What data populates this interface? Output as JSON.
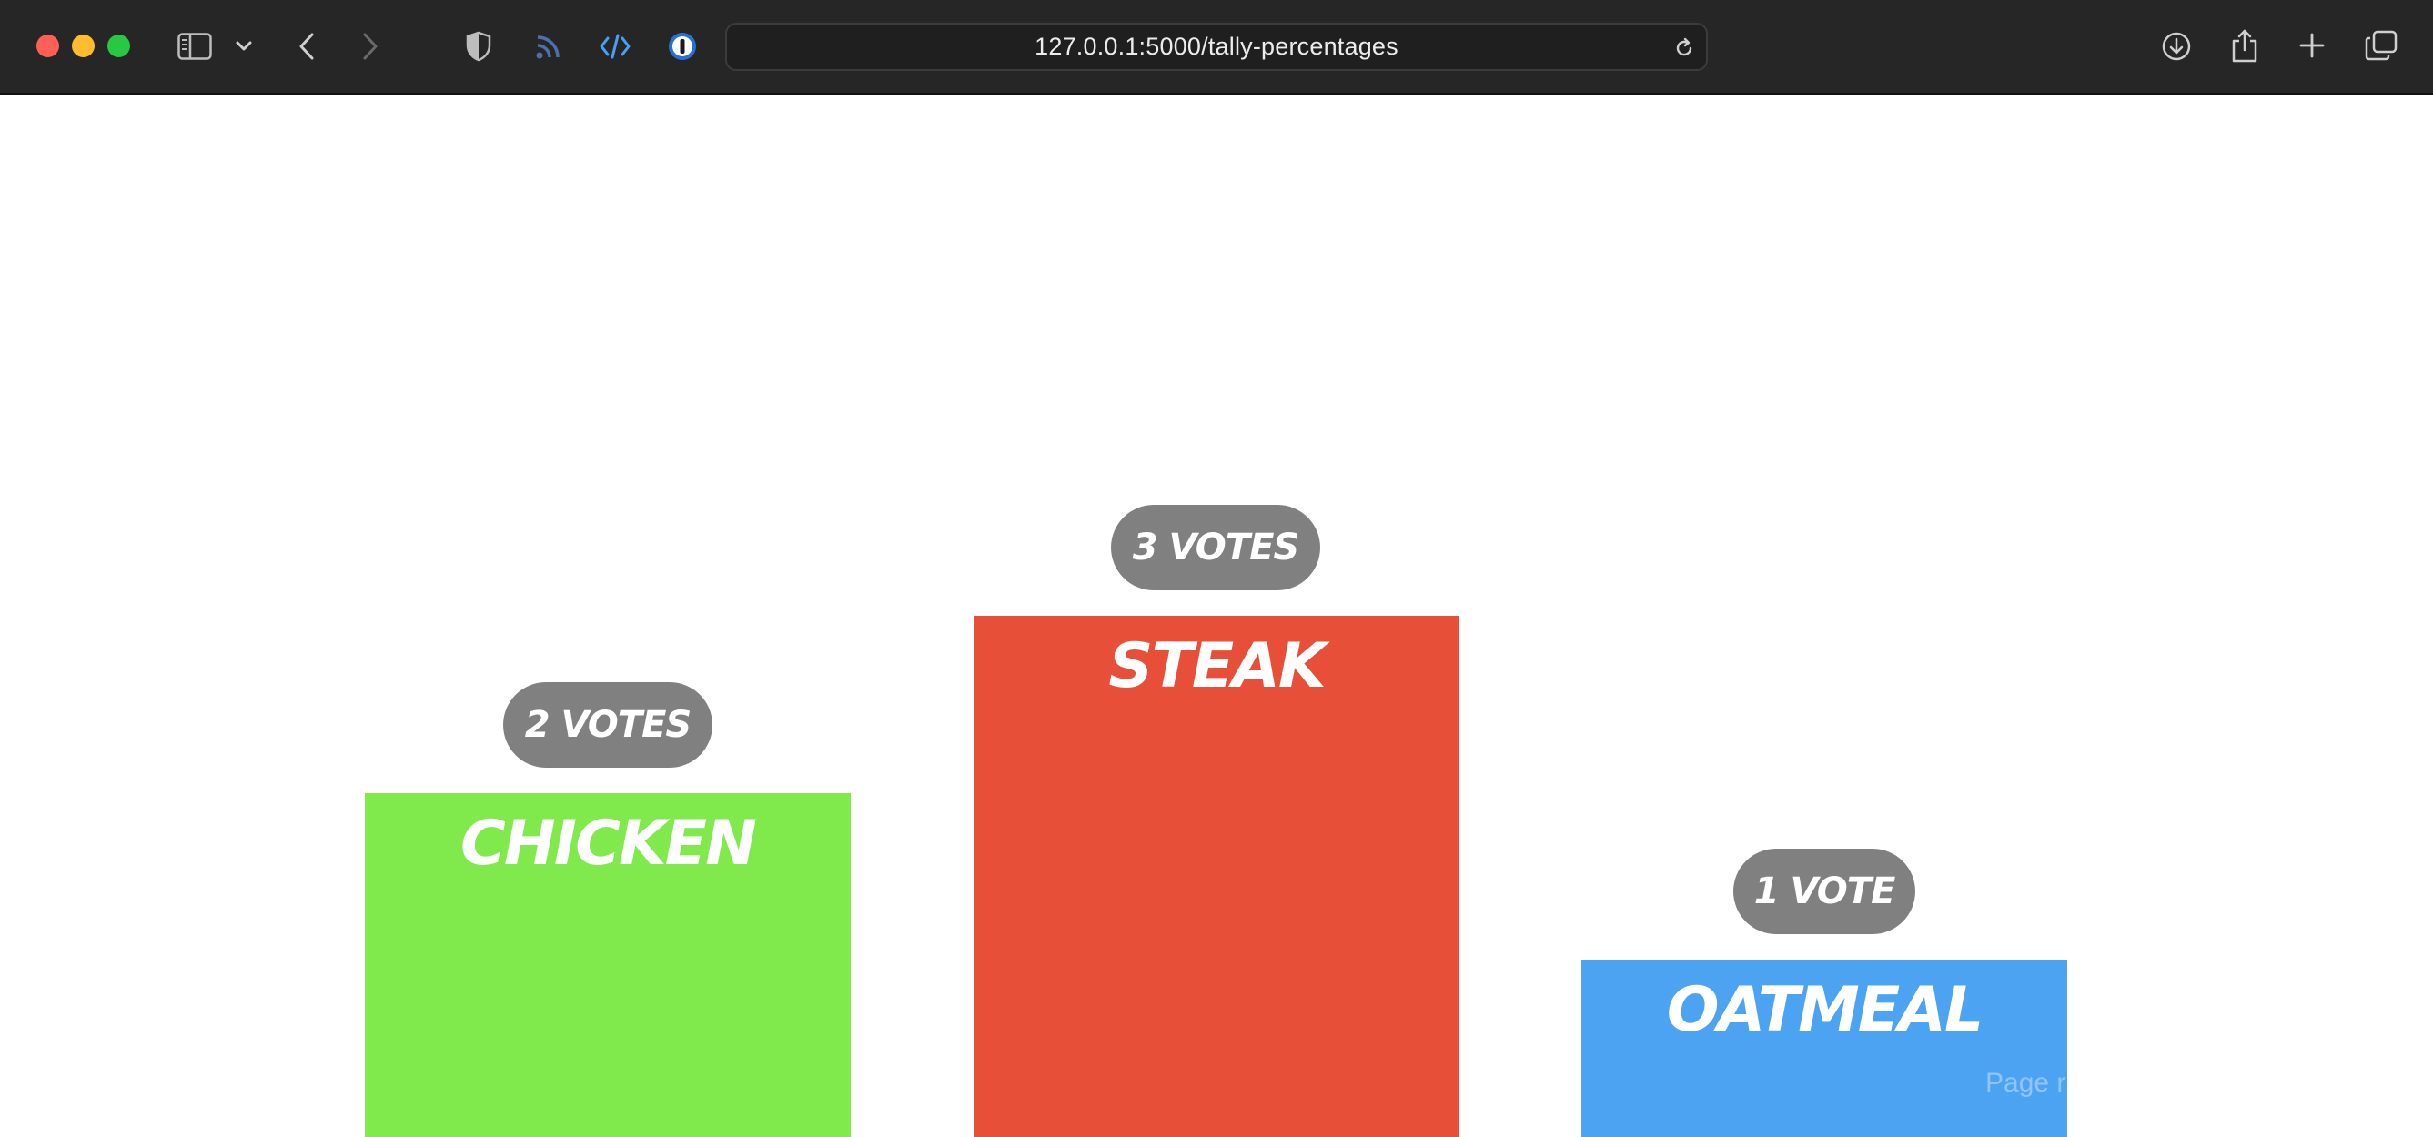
{
  "browser": {
    "url": "127.0.0.1:5000/tally-percentages",
    "traffic_lights": {
      "close": "#ff5f57",
      "minimize": "#febc2e",
      "zoom": "#28c840"
    },
    "icons": [
      "sidebar-icon",
      "chevron-down-icon",
      "back-icon",
      "forward-icon",
      "shield-icon",
      "rss-icon",
      "code-icon",
      "password-manager-icon",
      "reload-icon",
      "download-icon",
      "share-icon",
      "new-tab-icon",
      "tab-overview-icon"
    ]
  },
  "tally": {
    "pill_color": "#808080",
    "items": [
      {
        "label": "Chicken",
        "votes_text": "2 VOTES",
        "votes": 2,
        "color": "#80ea4d"
      },
      {
        "label": "Steak",
        "votes_text": "3 VOTES",
        "votes": 3,
        "color": "#e84f39"
      },
      {
        "label": "Oatmeal",
        "votes_text": "1 VOTE",
        "votes": 1,
        "color": "#4ba3f1"
      }
    ],
    "footer_note": "Page r"
  }
}
